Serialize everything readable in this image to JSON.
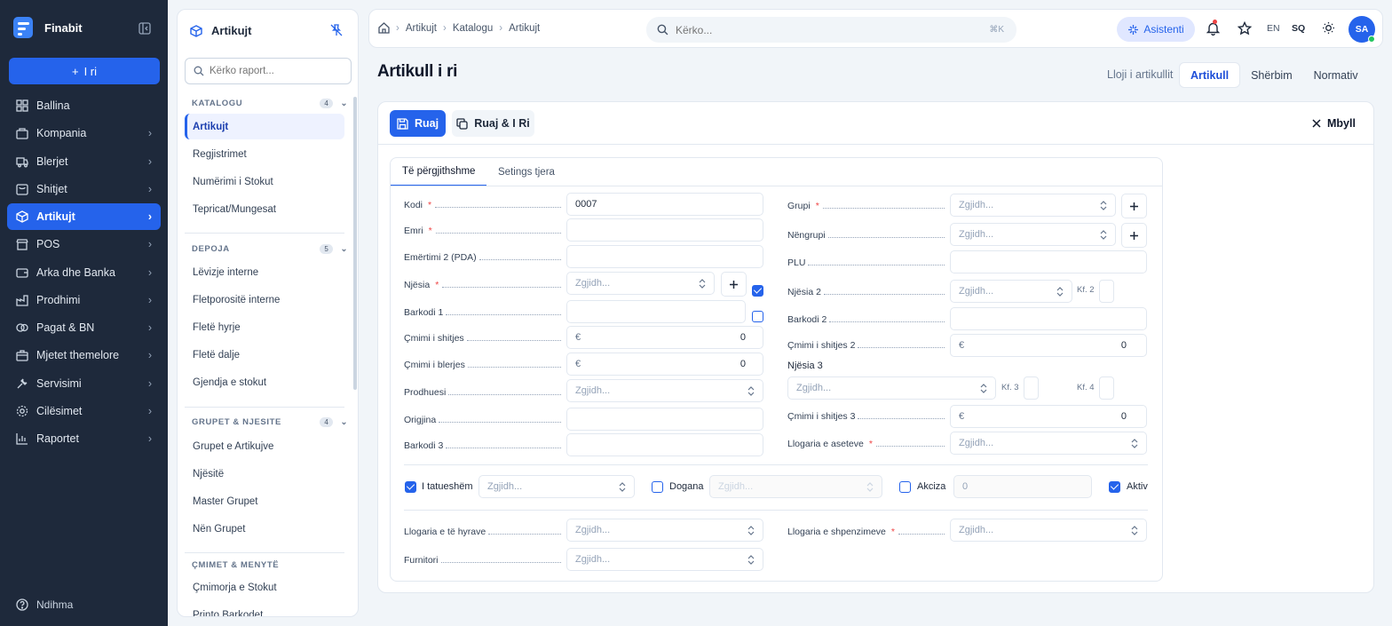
{
  "brand": {
    "name": "Finabit"
  },
  "sidebar": {
    "new_label": "I ri",
    "items": [
      {
        "label": "Ballina"
      },
      {
        "label": "Kompania"
      },
      {
        "label": "Blerjet"
      },
      {
        "label": "Shitjet"
      },
      {
        "label": "Artikujt"
      },
      {
        "label": "POS"
      },
      {
        "label": "Arka dhe Banka"
      },
      {
        "label": "Prodhimi"
      },
      {
        "label": "Pagat & BN"
      },
      {
        "label": "Mjetet themelore"
      },
      {
        "label": "Servisimi"
      },
      {
        "label": "Cilësimet"
      },
      {
        "label": "Raportet"
      }
    ],
    "help_label": "Ndihma"
  },
  "report_panel": {
    "title": "Artikujt",
    "search_placeholder": "Kërko raport...",
    "sections": [
      {
        "title": "KATALOGU",
        "count": "4",
        "items": [
          "Artikujt",
          "Regjistrimet",
          "Numërimi i Stokut",
          "Tepricat/Mungesat"
        ]
      },
      {
        "title": "DEPOJA",
        "count": "5",
        "items": [
          "Lëvizje interne",
          "Fletporositë interne",
          "Fletë hyrje",
          "Fletë dalje",
          "Gjendja e stokut"
        ]
      },
      {
        "title": "GRUPET & NJESITE",
        "count": "4",
        "items": [
          "Grupet e Artikujve",
          "Njësitë",
          "Master Grupet",
          "Nën Grupet"
        ]
      },
      {
        "title": "ÇMIMET & MENYTË",
        "items": [
          "Çmimorja e Stokut",
          "Printo Barkodet"
        ]
      }
    ]
  },
  "topbar": {
    "breadcrumb": [
      "Artikujt",
      "Katalogu",
      "Artikujt"
    ],
    "search_placeholder": "Kërko...",
    "search_shortcut": "⌘K",
    "assistant_label": "Asistenti",
    "lang_en": "EN",
    "lang_sq": "SQ",
    "avatar_initials": "SA"
  },
  "page": {
    "title": "Artikull i ri",
    "type_label": "Lloji i artikullit",
    "types": [
      "Artikull",
      "Shërbim",
      "Normativ"
    ],
    "selected_type": "Artikull"
  },
  "toolbar": {
    "save_label": "Ruaj",
    "save_new_label": "Ruaj & I Ri",
    "close_label": "Mbyll"
  },
  "tabs": [
    "Të përgjithshme",
    "Setings tjera"
  ],
  "form": {
    "select_placeholder": "Zgjidh...",
    "currency": "€",
    "left": {
      "kodi": {
        "label": "Kodi",
        "value": "0007"
      },
      "emri": {
        "label": "Emri",
        "value": ""
      },
      "emertimi2": {
        "label": "Emërtimi 2 (PDA)",
        "value": ""
      },
      "njesia": {
        "label": "Njësia"
      },
      "barkodi1": {
        "label": "Barkodi 1",
        "value": ""
      },
      "cmimi_shitjes": {
        "label": "Çmimi i shitjes",
        "value": "0"
      },
      "cmimi_blerjes": {
        "label": "Çmimi i blerjes",
        "value": "0"
      },
      "prodhuesi": {
        "label": "Prodhuesi"
      },
      "origjina": {
        "label": "Origjina",
        "value": ""
      },
      "barkodi3": {
        "label": "Barkodi 3",
        "value": ""
      }
    },
    "right": {
      "grupi": {
        "label": "Grupi"
      },
      "nengrupi": {
        "label": "Nëngrupi"
      },
      "plu": {
        "label": "PLU",
        "value": ""
      },
      "njesia2": {
        "label": "Njësia 2",
        "kf": "Kf. 2"
      },
      "barkodi2": {
        "label": "Barkodi 2",
        "value": ""
      },
      "cmimi_shitjes2": {
        "label": "Çmimi i shitjes 2",
        "value": "0"
      },
      "njesia3": {
        "label": "Njësia 3",
        "kf3": "Kf. 3",
        "kf4": "Kf. 4"
      },
      "cmimi_shitjes3": {
        "label": "Çmimi i shitjes 3",
        "value": "0"
      },
      "llogaria_aseteve": {
        "label": "Llogaria e aseteve"
      }
    },
    "checks": {
      "tatueshem": {
        "label": "I tatueshëm",
        "checked": true
      },
      "dogana": {
        "label": "Dogana",
        "checked": false
      },
      "akciza": {
        "label": "Akciza",
        "checked": false,
        "value": "0"
      },
      "aktiv": {
        "label": "Aktiv",
        "checked": true
      }
    },
    "bottom": {
      "llogaria_hyrave": {
        "label": "Llogaria e të hyrave"
      },
      "llogaria_shpenzimeve": {
        "label": "Llogaria e shpenzimeve"
      },
      "furnitori": {
        "label": "Furnitori"
      }
    }
  },
  "colors": {
    "accent": "#2563eb",
    "sidebar_bg": "#1e293b",
    "required": "#ef4444"
  }
}
